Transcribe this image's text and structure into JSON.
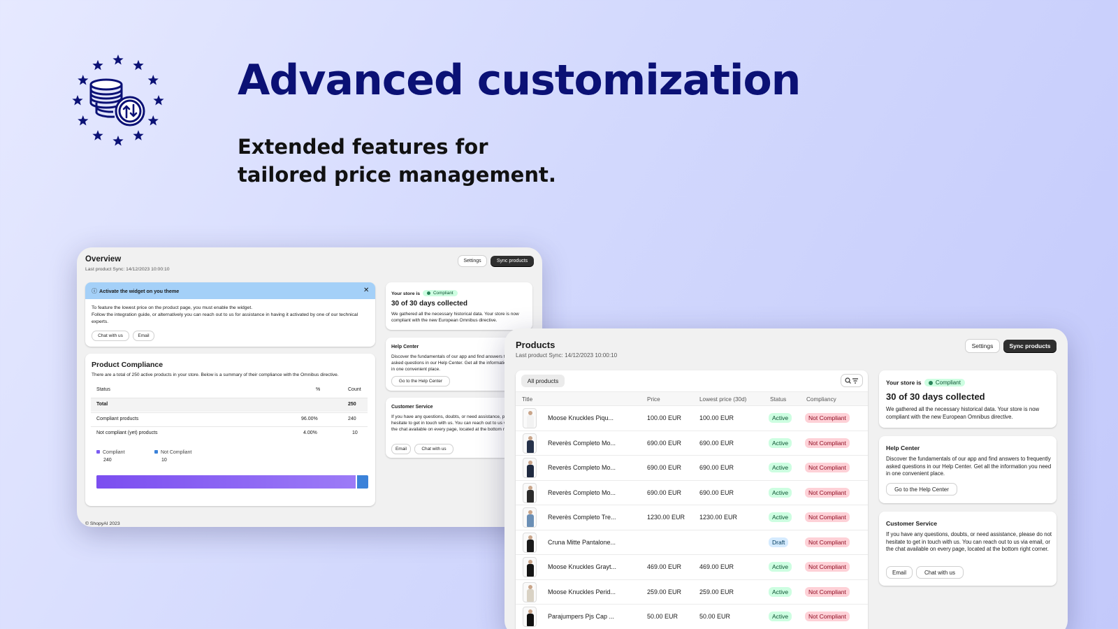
{
  "hero": {
    "title": "Advanced customization",
    "subtitle": "Extended features for tailored price management."
  },
  "colors": {
    "brand_navy": "#0b1175",
    "compliant": "#7b5cf2",
    "not_compliant": "#3b82d9",
    "banner": "#a4d0f8",
    "dark_button": "#2f2f2f"
  },
  "overview": {
    "title": "Overview",
    "last_sync": "Last product Sync: 14/12/2023 10:00:10",
    "settings_label": "Settings",
    "sync_label": "Sync products",
    "banner": {
      "title": "Activate the widget on you theme",
      "line1": "To feature the lowest price on the product page, you must enable the widget.",
      "line2": "Follow the integration guide, or alternatively you can reach out to us for assistance in having it activated by one of our technical experts.",
      "chat_label": "Chat with us",
      "email_label": "Email"
    },
    "compliance": {
      "title": "Product Compliance",
      "description": "There are a total of 250 active products in your store. Below is a summary of their compliance with the Omnibus directive.",
      "headers": {
        "status": "Status",
        "percent": "%",
        "count": "Count"
      },
      "rows": [
        {
          "status": "Total",
          "percent": "",
          "count": "250"
        },
        {
          "status": "Compliant products",
          "percent": "96.00%",
          "count": "240"
        },
        {
          "status": "Not compliant (yet) products",
          "percent": "4.00%",
          "count": "10"
        }
      ],
      "legend": [
        {
          "label": "Compliant",
          "value": "240"
        },
        {
          "label": "Not Compliant",
          "value": "10"
        }
      ],
      "bar_fraction_compliant": 0.96
    },
    "store_card": {
      "prefix": "Your store is",
      "badge": "Compliant",
      "heading": "30 of 30 days collected",
      "text": "We gathered all the necessary historical data. Your store is now compliant with the new European Omnibus directive."
    },
    "help": {
      "title": "Help Center",
      "text": "Discover the fundamentals of our app and find answers to frequently asked questions in our Help Center. Get all the information you need in one convenient place.",
      "button": "Go to the Help Center"
    },
    "service": {
      "title": "Customer Service",
      "text": "If you have any questions, doubts, or need assistance, please do not hesitate to get in touch with us. You can reach out to us via email, or the chat available on every page, located at the bottom right corner.",
      "email_label": "Email",
      "chat_label": "Chat with us"
    },
    "footer": "© ShopyAI 2023"
  },
  "products": {
    "title": "Products",
    "last_sync": "Last product Sync: 14/12/2023 10:00:10",
    "settings_label": "Settings",
    "sync_label": "Sync products",
    "filter_tab": "All products",
    "headers": {
      "title": "Title",
      "price": "Price",
      "lowest": "Lowest price (30d)",
      "status": "Status",
      "compliancy": "Compliancy"
    },
    "rows": [
      {
        "title": "Moose Knuckles Piqu...",
        "price": "100.00 EUR",
        "lowest": "100.00 EUR",
        "status": "Active",
        "compliancy": "Not Compliant",
        "outfit": "#f2f2f2"
      },
      {
        "title": "Reverès Completo Mo...",
        "price": "690.00 EUR",
        "lowest": "690.00 EUR",
        "status": "Active",
        "compliancy": "Not Compliant",
        "outfit": "#26324a"
      },
      {
        "title": "Reverès Completo Mo...",
        "price": "690.00 EUR",
        "lowest": "690.00 EUR",
        "status": "Active",
        "compliancy": "Not Compliant",
        "outfit": "#1f2a40"
      },
      {
        "title": "Reverès Completo Mo...",
        "price": "690.00 EUR",
        "lowest": "690.00 EUR",
        "status": "Active",
        "compliancy": "Not Compliant",
        "outfit": "#2b2b2b"
      },
      {
        "title": "Reverès Completo Tre...",
        "price": "1230.00 EUR",
        "lowest": "1230.00 EUR",
        "status": "Active",
        "compliancy": "Not Compliant",
        "outfit": "#6b8fb5"
      },
      {
        "title": "Cruna Mitte Pantalone...",
        "price": "",
        "lowest": "",
        "status": "Draft",
        "compliancy": "Not Compliant",
        "outfit": "#1a1a1a"
      },
      {
        "title": "Moose Knuckles Grayt...",
        "price": "469.00 EUR",
        "lowest": "469.00 EUR",
        "status": "Active",
        "compliancy": "Not Compliant",
        "outfit": "#151515"
      },
      {
        "title": "Moose Knuckles Perid...",
        "price": "259.00 EUR",
        "lowest": "259.00 EUR",
        "status": "Active",
        "compliancy": "Not Compliant",
        "outfit": "#d9d2c4"
      },
      {
        "title": "Parajumpers Pjs Cap ...",
        "price": "50.00 EUR",
        "lowest": "50.00 EUR",
        "status": "Active",
        "compliancy": "Not Compliant",
        "outfit": "#111111"
      }
    ],
    "store_card": {
      "prefix": "Your store is",
      "badge": "Compliant",
      "heading": "30 of 30 days collected",
      "text": "We gathered all the necessary historical data. Your store is now compliant with the new European Omnibus directive."
    },
    "help": {
      "title": "Help Center",
      "text": "Discover the fundamentals of our app and find answers to frequently asked questions in our Help Center. Get all the information you need in one convenient place.",
      "button": "Go to the Help Center"
    },
    "service": {
      "title": "Customer Service",
      "text": "If you have any questions, doubts, or need assistance, please do not hesitate to get in touch with us. You can reach out to us via email, or the chat available on every page, located at the bottom right corner.",
      "email_label": "Email",
      "chat_label": "Chat with us"
    }
  }
}
